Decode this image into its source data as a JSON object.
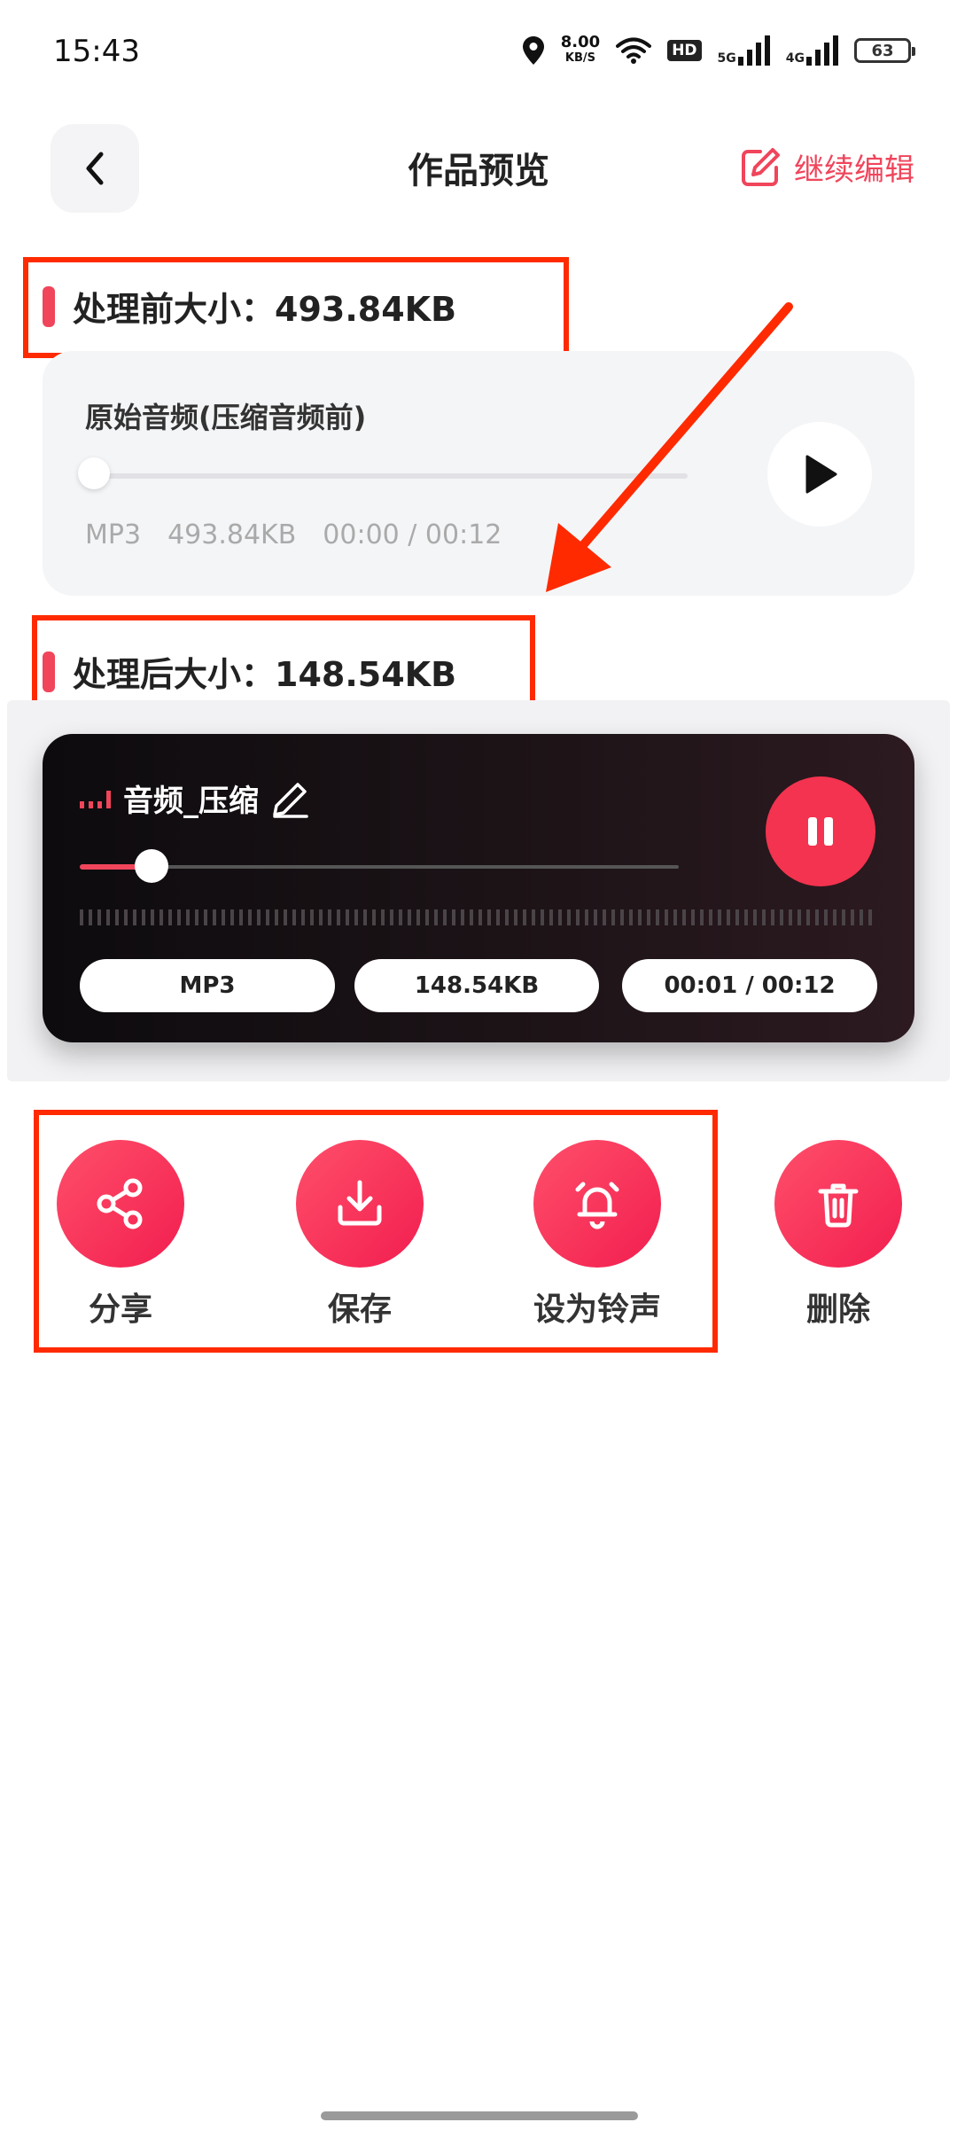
{
  "status_bar": {
    "time": "15:43",
    "net_speed_value": "8.00",
    "net_speed_unit": "KB/S",
    "hd_label": "HD",
    "sig1_label": "5G",
    "sig2_label": "4G",
    "battery": "63"
  },
  "header": {
    "title": "作品预览",
    "continue_edit": "继续编辑"
  },
  "before": {
    "label": "处理前大小：493.84KB",
    "card_title": "原始音频(压缩音频前)",
    "format": "MP3",
    "size": "493.84KB",
    "time": "00:00 / 00:12",
    "progress": 0
  },
  "after": {
    "label": "处理后大小：148.54KB",
    "card_title": "音频_压缩",
    "format": "MP3",
    "size": "148.54KB",
    "time": "00:01 / 00:12",
    "progress": 0.12
  },
  "actions": [
    {
      "label": "分享",
      "icon": "share-icon"
    },
    {
      "label": "保存",
      "icon": "download-icon"
    },
    {
      "label": "设为铃声",
      "icon": "bell-icon"
    },
    {
      "label": "删除",
      "icon": "trash-icon"
    }
  ],
  "colors": {
    "accent": "#f0455b",
    "annotation_red": "#ff2a00"
  }
}
